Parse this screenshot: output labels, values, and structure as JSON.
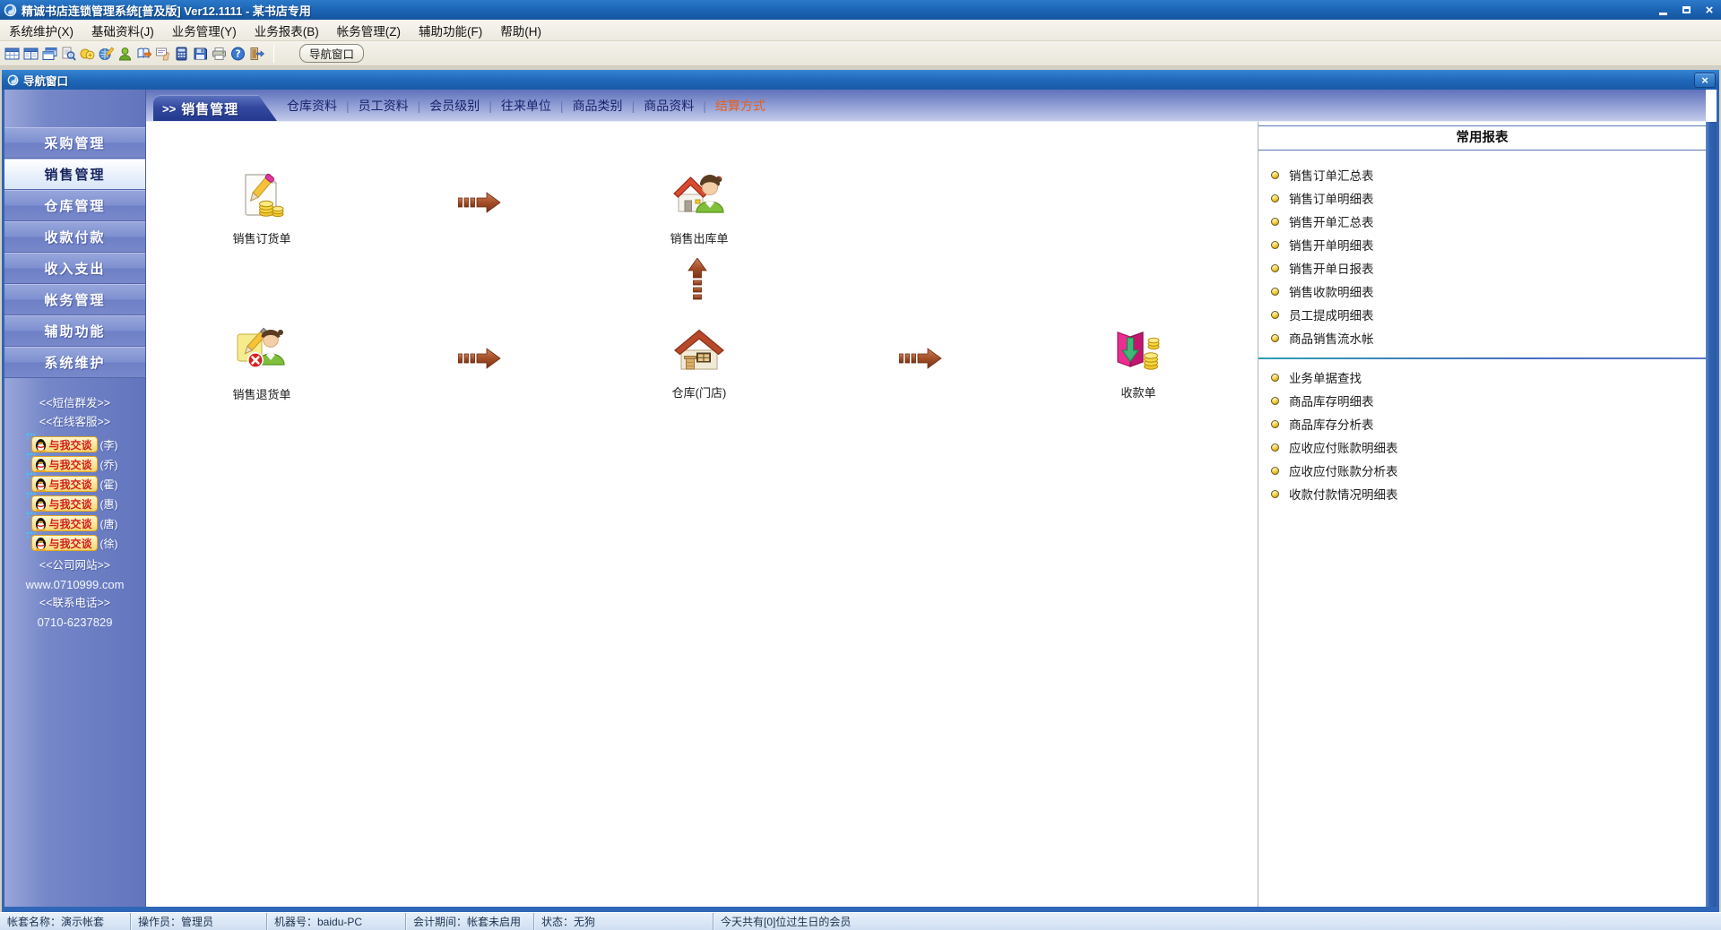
{
  "titlebar": {
    "title": "精诚书店连锁管理系统[普及版] Ver12.1111  -  某书店专用"
  },
  "menubar": {
    "items": [
      "系统维护(X)",
      "基础资料(J)",
      "业务管理(Y)",
      "业务报表(B)",
      "帐务管理(Z)",
      "辅助功能(F)",
      "帮助(H)"
    ]
  },
  "toolbar": {
    "icons": [
      "grid-icon",
      "form-icon",
      "windows-icon",
      "search-doc-icon",
      "coins-icon",
      "globe-edit-icon",
      "user-icon",
      "book-export-icon",
      "hand-edit-icon",
      "calculator-icon",
      "save-icon",
      "print-icon",
      "help-icon",
      "exit-icon"
    ],
    "nav_button": "导航窗口"
  },
  "nav_window": {
    "title": "导航窗口",
    "close": "×"
  },
  "sidebar": {
    "modules": [
      "采购管理",
      "销售管理",
      "仓库管理",
      "收款付款",
      "收入支出",
      "帐务管理",
      "辅助功能",
      "系统维护"
    ],
    "selected": "销售管理",
    "links": {
      "sms": "<<短信群发>>",
      "service": "<<在线客服>>",
      "site_label": "<<公司网站>>",
      "site_url": "www.0710999.com",
      "phone_label": "<<联系电话>>",
      "phone": "0710-6237829"
    },
    "qq": {
      "button_label": "与我交谈",
      "contacts": [
        "(李)",
        "(乔)",
        "(霍)",
        "(惠)",
        "(唐)",
        "(徐)"
      ]
    }
  },
  "tabstrip": {
    "prefix": ">>",
    "active": "销售管理",
    "links": [
      "仓库资料",
      "员工资料",
      "会员级别",
      "往来单位",
      "商品类别",
      "商品资料",
      "结算方式"
    ],
    "highlight_color": "#e8601c"
  },
  "flow": {
    "nodes": [
      {
        "label": "销售订货单"
      },
      {
        "label": "销售出库单"
      },
      {
        "label": "销售退货单"
      },
      {
        "label": "仓库(门店)"
      },
      {
        "label": "收款单"
      }
    ]
  },
  "reports": {
    "title": "常用报表",
    "group1": [
      "销售订单汇总表",
      "销售订单明细表",
      "销售开单汇总表",
      "销售开单明细表",
      "销售开单日报表",
      "销售收款明细表",
      "员工提成明细表",
      "商品销售流水帐"
    ],
    "group2": [
      "业务单据查找",
      "商品库存明细表",
      "商品库存分析表",
      "应收应付账款明细表",
      "应收应付账款分析表",
      "收款付款情况明细表"
    ]
  },
  "statusbar": {
    "segments": [
      "帐套名称：演示帐套",
      "操作员：管理员",
      "机器号：baidu-PC",
      "会计期间：帐套未启用",
      "状态：无狗",
      "今天共有[0]位过生日的会员"
    ]
  },
  "colors": {
    "titlebar_blue": "#1b63b4",
    "sidebar_blue": "#6e7fc2",
    "accent_orange": "#e8601c",
    "arrow_brown": "#a44f28"
  }
}
